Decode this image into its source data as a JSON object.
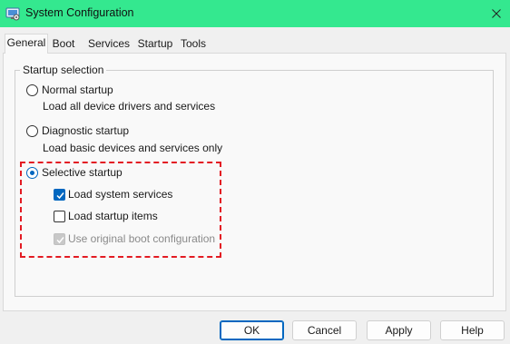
{
  "window": {
    "title": "System Configuration",
    "accent_color": "#34e88f",
    "icons": {
      "app": "system-config-icon",
      "close": "close-icon"
    }
  },
  "tabs": [
    {
      "label": "General",
      "selected": true
    },
    {
      "label": "Boot",
      "selected": false
    },
    {
      "label": "Services",
      "selected": false
    },
    {
      "label": "Startup",
      "selected": false
    },
    {
      "label": "Tools",
      "selected": false
    }
  ],
  "startup_selection": {
    "group_label": "Startup selection",
    "normal": {
      "label": "Normal startup",
      "description": "Load all device drivers and services",
      "selected": false
    },
    "diagnostic": {
      "label": "Diagnostic startup",
      "description": "Load basic devices and services only",
      "selected": false
    },
    "selective": {
      "label": "Selective startup",
      "selected": true,
      "options": [
        {
          "label": "Load system services",
          "checked": true,
          "enabled": true
        },
        {
          "label": "Load startup items",
          "checked": false,
          "enabled": true
        },
        {
          "label": "Use original boot configuration",
          "checked": true,
          "enabled": false
        }
      ]
    }
  },
  "annotation": {
    "highlight_color": "#e31b23",
    "style": "dashed"
  },
  "buttons": {
    "ok": "OK",
    "cancel": "Cancel",
    "apply": "Apply",
    "help": "Help"
  }
}
